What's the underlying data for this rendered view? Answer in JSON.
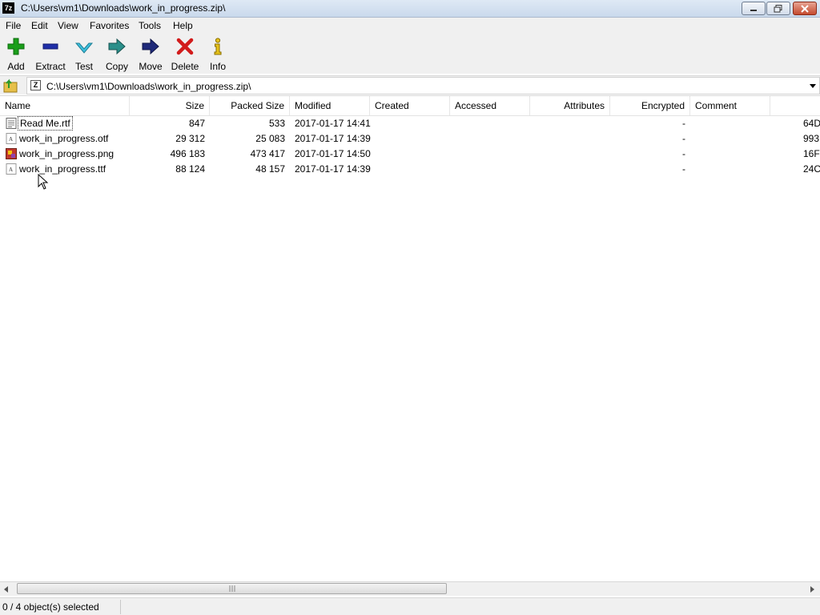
{
  "window": {
    "title": "C:\\Users\\vm1\\Downloads\\work_in_progress.zip\\",
    "app_icon_text": "7z"
  },
  "menu": [
    {
      "label": "File"
    },
    {
      "label": "Edit"
    },
    {
      "label": "View"
    },
    {
      "label": "Favorites"
    },
    {
      "label": "Tools"
    },
    {
      "label": "Help"
    }
  ],
  "toolbar": {
    "add": {
      "label": "Add",
      "icon": "plus-icon",
      "color": "#1a9e1a"
    },
    "extract": {
      "label": "Extract",
      "icon": "minus-icon",
      "color": "#1f2fa8"
    },
    "test": {
      "label": "Test",
      "icon": "check-icon",
      "color": "#2aa6c4"
    },
    "copy": {
      "label": "Copy",
      "icon": "arrow-right-icon",
      "color": "#2a8f8a"
    },
    "move": {
      "label": "Move",
      "icon": "arrow-right-icon",
      "color": "#1f2a7a"
    },
    "delete": {
      "label": "Delete",
      "icon": "x-icon",
      "color": "#d21b1b"
    },
    "info": {
      "label": "Info",
      "icon": "info-icon",
      "color": "#c9a000"
    }
  },
  "address": {
    "path": "C:\\Users\\vm1\\Downloads\\work_in_progress.zip\\"
  },
  "columns": [
    {
      "label": "Name"
    },
    {
      "label": "Size"
    },
    {
      "label": "Packed Size"
    },
    {
      "label": "Modified"
    },
    {
      "label": "Created"
    },
    {
      "label": "Accessed"
    },
    {
      "label": "Attributes"
    },
    {
      "label": "Encrypted"
    },
    {
      "label": "Comment"
    }
  ],
  "files": [
    {
      "name": "Read Me.rtf",
      "size": "847",
      "packed": "533",
      "modified": "2017-01-17 14:41",
      "encrypted": "-",
      "crc": "64D",
      "icon": "rtf-document-icon"
    },
    {
      "name": "work_in_progress.otf",
      "size": "29 312",
      "packed": "25 083",
      "modified": "2017-01-17 14:39",
      "encrypted": "-",
      "crc": "993",
      "icon": "font-file-icon"
    },
    {
      "name": "work_in_progress.png",
      "size": "496 183",
      "packed": "473 417",
      "modified": "2017-01-17 14:50",
      "encrypted": "-",
      "crc": "16F",
      "icon": "image-file-icon"
    },
    {
      "name": "work_in_progress.ttf",
      "size": "88 124",
      "packed": "48 157",
      "modified": "2017-01-17 14:39",
      "encrypted": "-",
      "crc": "24C",
      "icon": "font-file-icon"
    }
  ],
  "status": {
    "selection": "0 / 4 object(s) selected"
  }
}
